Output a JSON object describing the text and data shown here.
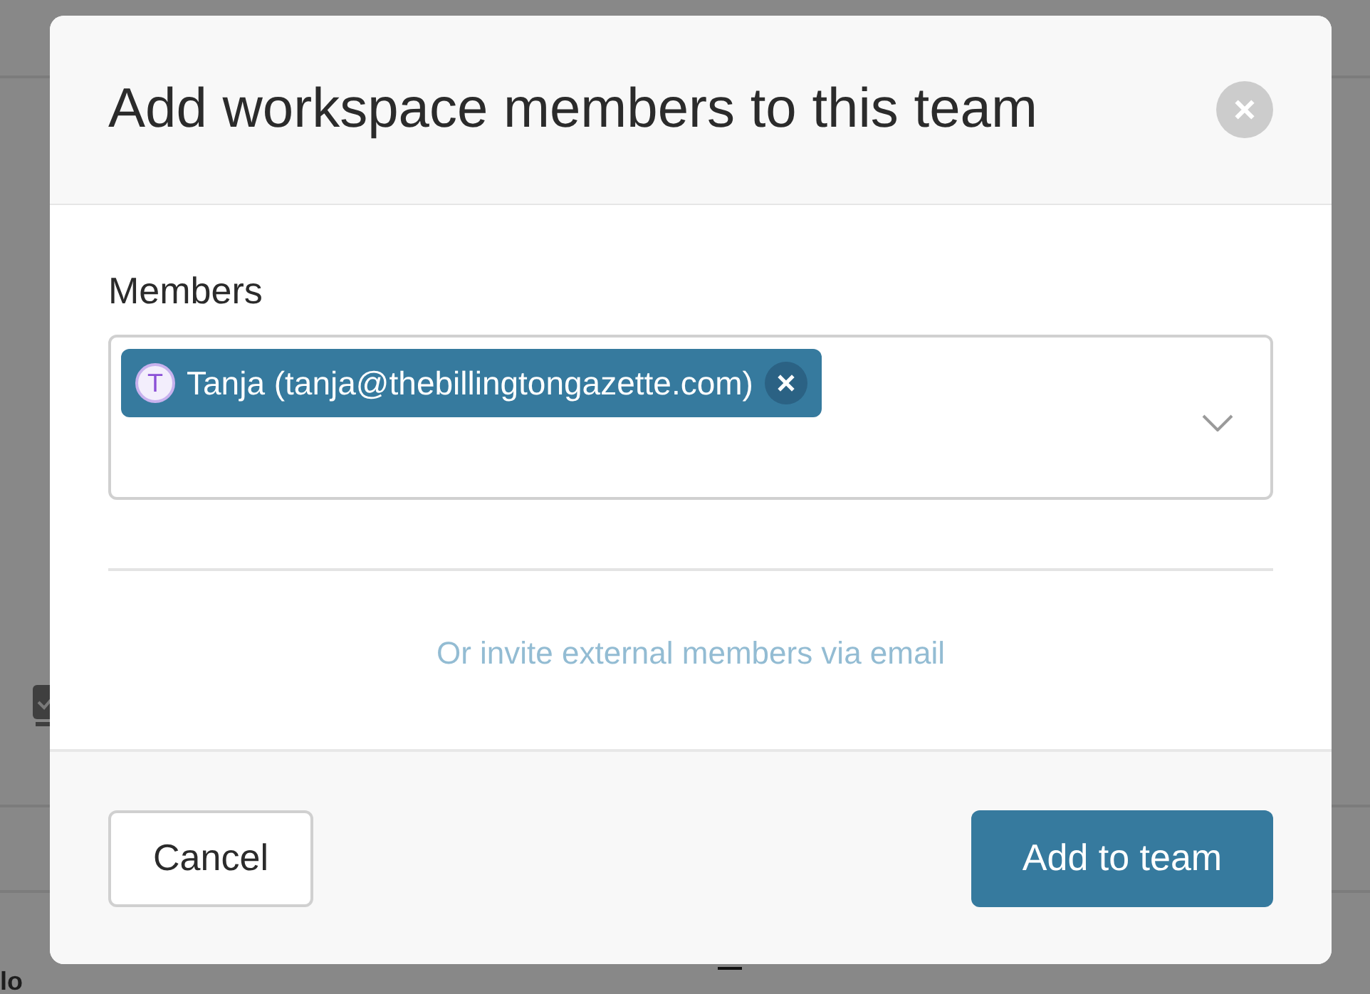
{
  "background": {
    "corner_text": "lo"
  },
  "dialog": {
    "title": "Add workspace members to this team",
    "members_field": {
      "label": "Members",
      "chips": [
        {
          "initial": "T",
          "text": "Tanja (tanja@thebillingtongazette.com)"
        }
      ]
    },
    "invite_link": "Or invite external members via email",
    "buttons": [
      {
        "label": "Cancel",
        "kind": "secondary"
      },
      {
        "label": "Add to team",
        "kind": "primary"
      }
    ]
  }
}
